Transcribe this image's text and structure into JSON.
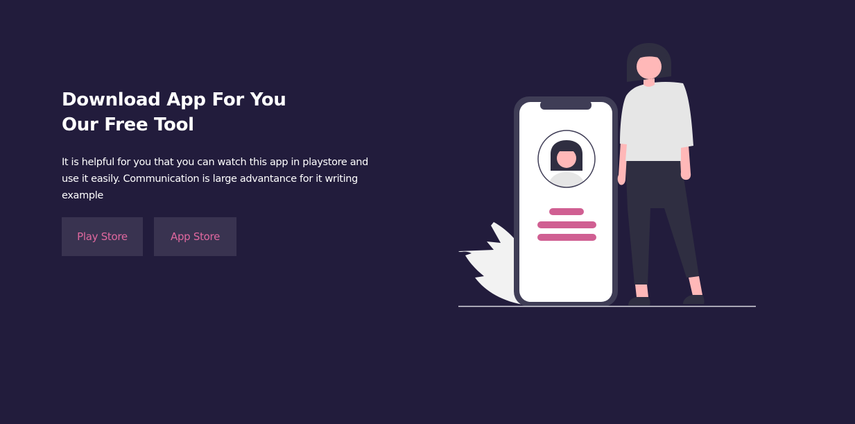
{
  "hero": {
    "title_line1": "Download App For You",
    "title_line2": "Our Free Tool",
    "description": "It is helpful for you that you can watch this app in playstore and use it easily. Communication is large advantance for it writing example"
  },
  "buttons": {
    "play_store": "Play Store",
    "app_store": "App Store"
  },
  "illustration": {
    "subject": "woman-standing-beside-phone",
    "icons": [
      "phone-icon",
      "avatar-icon",
      "leaf-icon"
    ]
  },
  "colors": {
    "background": "#221c3c",
    "button_bg": "#393350",
    "accent": "#e0689f",
    "text": "#ffffff",
    "phone_frame": "#3f3d56",
    "shirt": "#e6e6e6",
    "pants": "#2f2e41",
    "skin": "#ffb8b8"
  }
}
